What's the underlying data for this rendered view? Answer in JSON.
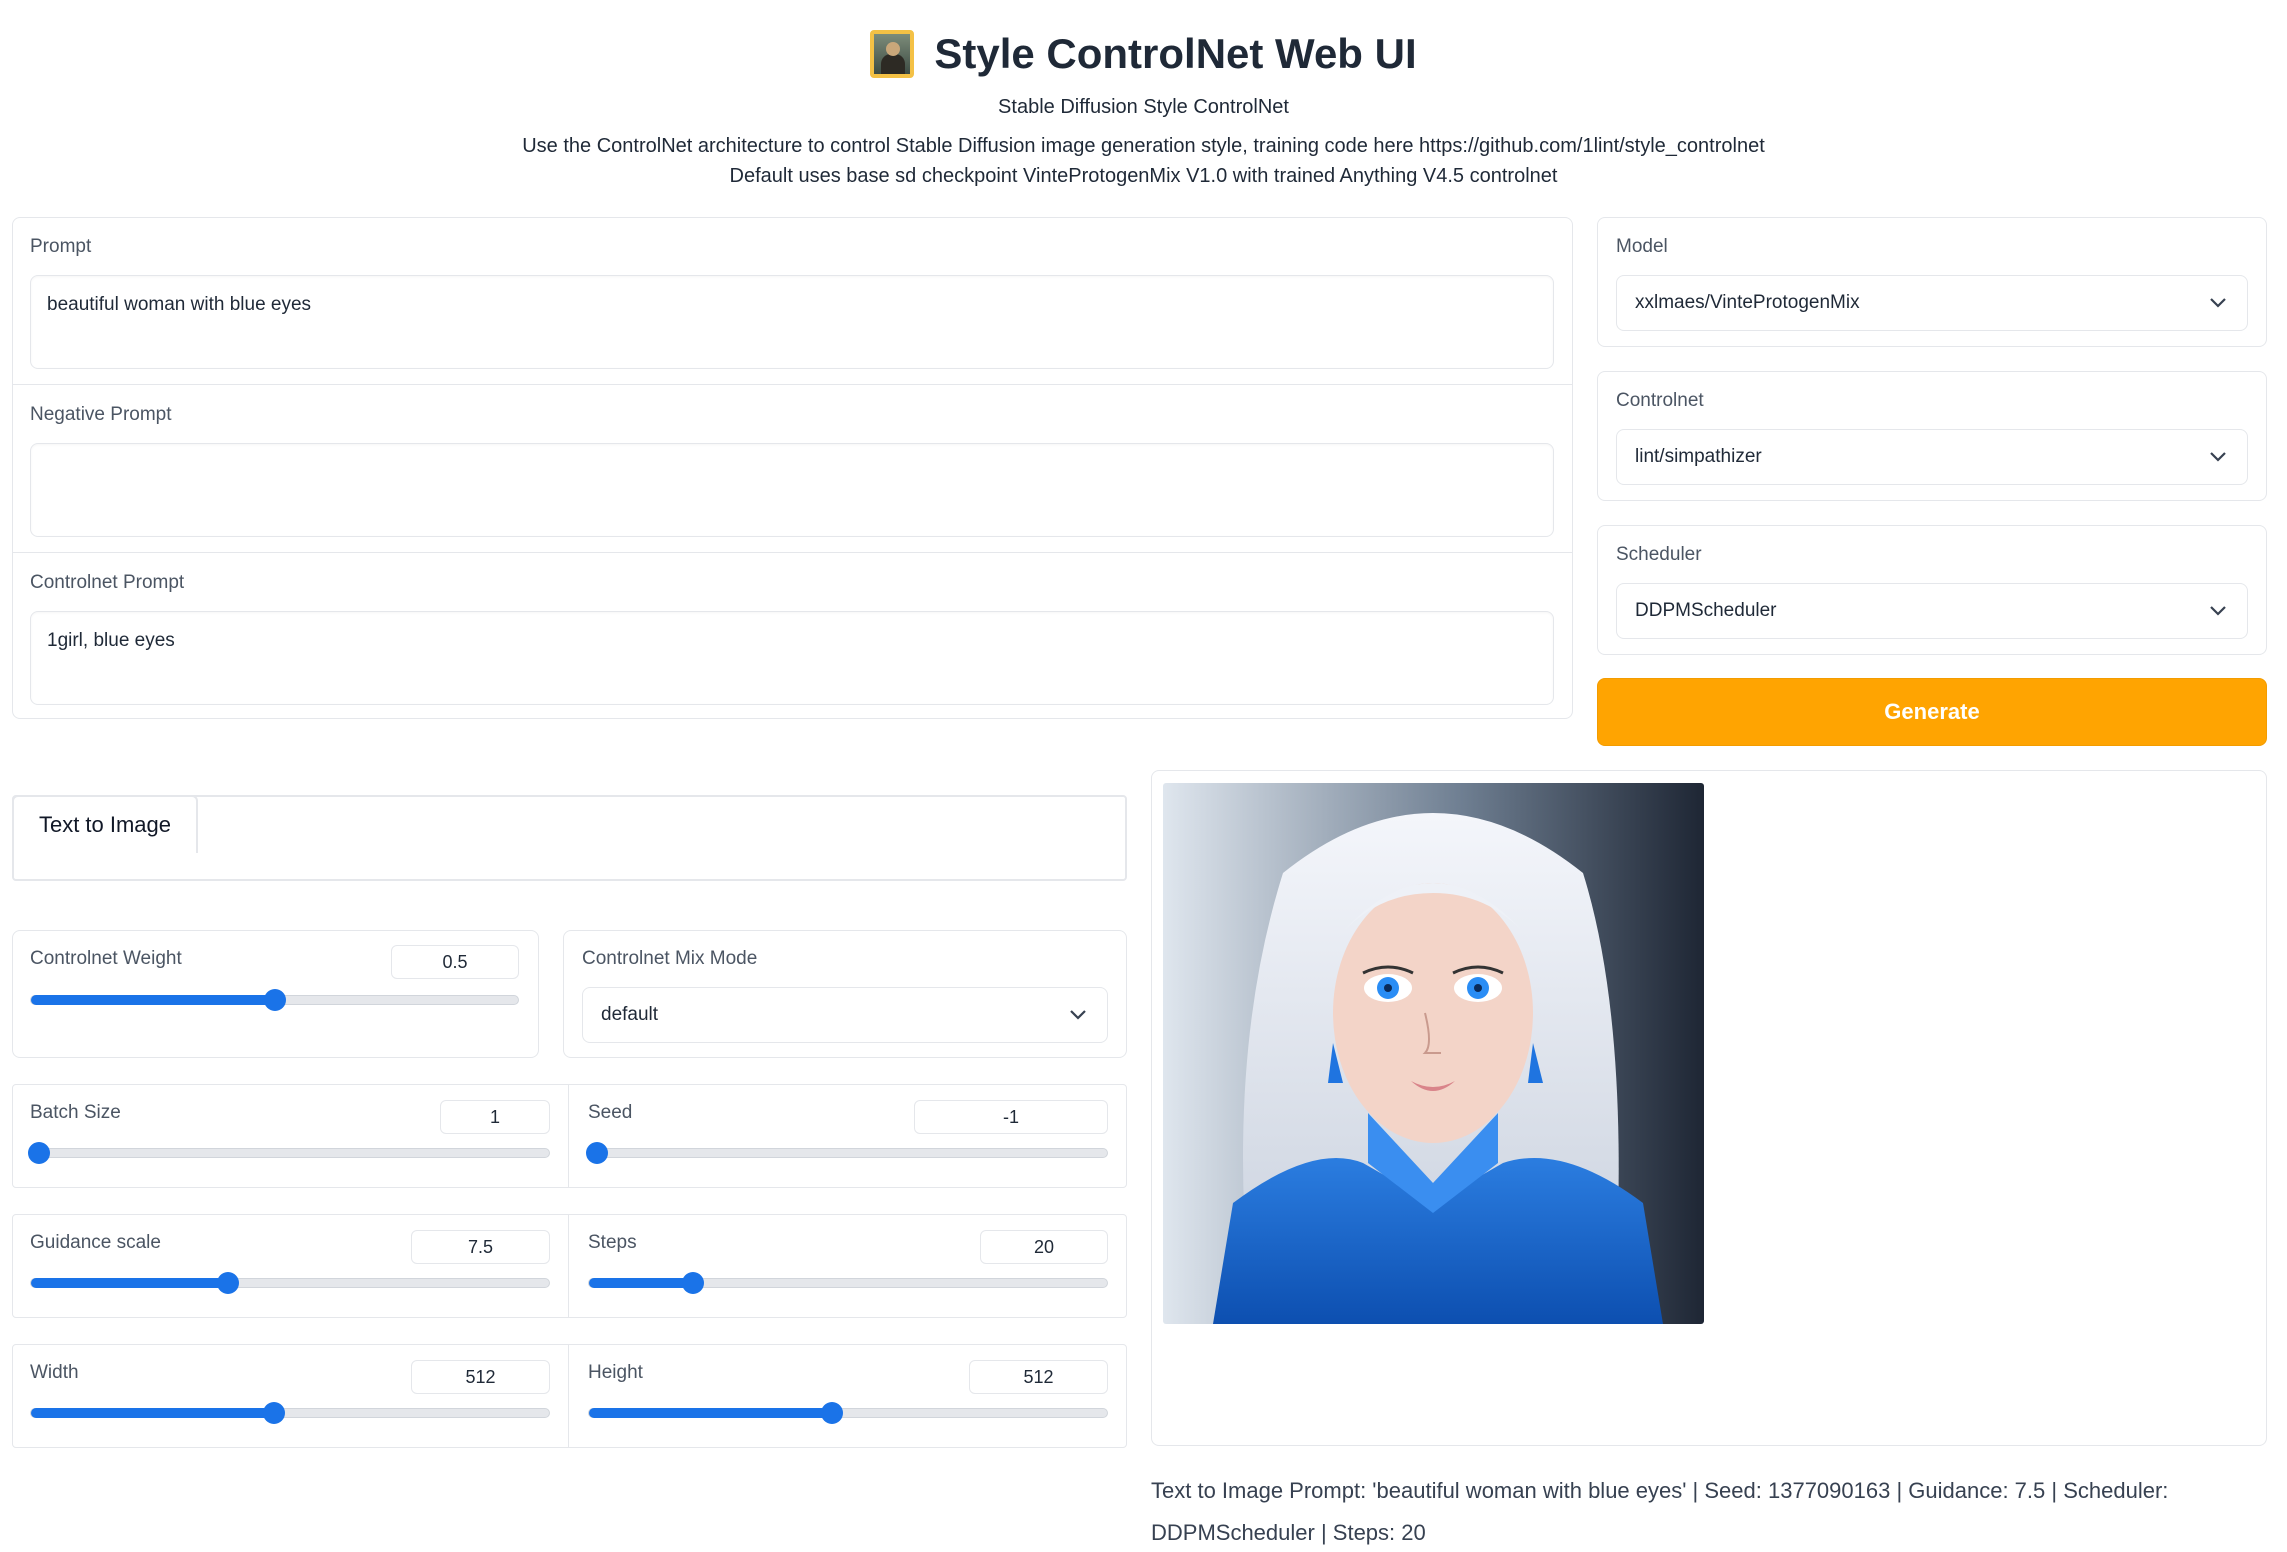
{
  "header": {
    "title": "Style ControlNet Web UI",
    "subtitle": "Stable Diffusion Style ControlNet",
    "description_line1": "Use the ControlNet architecture to control Stable Diffusion image generation style, training code here https://github.com/1lint/style_controlnet",
    "description_line2": "Default uses base sd checkpoint VinteProtogenMix V1.0 with trained Anything V4.5 controlnet",
    "icon": "framed-picture-icon"
  },
  "prompts": {
    "prompt_label": "Prompt",
    "prompt_value": "beautiful woman with blue eyes",
    "negative_label": "Negative Prompt",
    "negative_value": "",
    "controlnet_label": "Controlnet Prompt",
    "controlnet_value": "1girl, blue eyes"
  },
  "settings": {
    "model_label": "Model",
    "model_value": "xxlmaes/VinteProtogenMix",
    "controlnet_label": "Controlnet",
    "controlnet_value": "lint/simpathizer",
    "scheduler_label": "Scheduler",
    "scheduler_value": "DDPMScheduler",
    "generate_label": "Generate"
  },
  "tabs": {
    "active": "Text to Image"
  },
  "params": {
    "controlnet_weight": {
      "label": "Controlnet Weight",
      "value": "0.5",
      "fraction": 0.5
    },
    "mix_mode": {
      "label": "Controlnet Mix Mode",
      "value": "default"
    },
    "batch_size": {
      "label": "Batch Size",
      "value": "1",
      "fraction": 0.0
    },
    "seed": {
      "label": "Seed",
      "value": "-1",
      "fraction": 0.0
    },
    "guidance": {
      "label": "Guidance scale",
      "value": "7.5",
      "fraction": 0.38
    },
    "steps": {
      "label": "Steps",
      "value": "20",
      "fraction": 0.2
    },
    "width": {
      "label": "Width",
      "value": "512",
      "fraction": 0.47
    },
    "height": {
      "label": "Height",
      "value": "512",
      "fraction": 0.47
    }
  },
  "output": {
    "caption": "Text to Image Prompt: 'beautiful woman with blue eyes' | Seed: 1377090163 | Guidance: 7.5 | Scheduler: DDPMScheduler | Steps: 20"
  },
  "colors": {
    "accent": "#1a73e8",
    "generate": "#ffa401"
  }
}
